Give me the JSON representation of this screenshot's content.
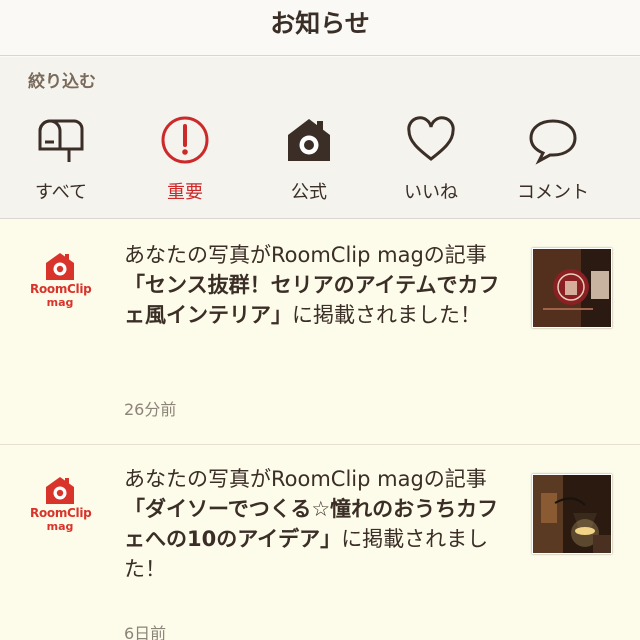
{
  "header": {
    "title": "お知らせ"
  },
  "filter": {
    "label": "絞り込む",
    "items": [
      {
        "label": "すべて",
        "icon": "mailbox-icon",
        "active": false
      },
      {
        "label": "重要",
        "icon": "exclamation-circle-icon",
        "active": true
      },
      {
        "label": "公式",
        "icon": "house-camera-icon",
        "active": false
      },
      {
        "label": "いいね",
        "icon": "heart-icon",
        "active": false
      },
      {
        "label": "コメント",
        "icon": "speech-bubble-icon",
        "active": false
      }
    ]
  },
  "brand": {
    "logo_text": "RoomClip",
    "logo_sub": "mag",
    "color": "#d9342c"
  },
  "notifications": [
    {
      "prefix": "あなたの写真がRoomClip magの記事",
      "title": "「センス抜群！セリアのアイテムでカフェ風インテリア」",
      "suffix": "に掲載されました！",
      "time": "26分前",
      "thumb_icon": "red-signboard-photo"
    },
    {
      "prefix": "あなたの写真がRoomClip magの記事",
      "title": "「ダイソーでつくる☆憧れのおうちカフェへの10のアイデア」",
      "suffix": "に掲載されました！",
      "time": "6日前",
      "thumb_icon": "wall-lamp-photo"
    }
  ],
  "colors": {
    "accent": "#cc2a2a",
    "text": "#3a2e26",
    "muted": "#8c847a"
  }
}
